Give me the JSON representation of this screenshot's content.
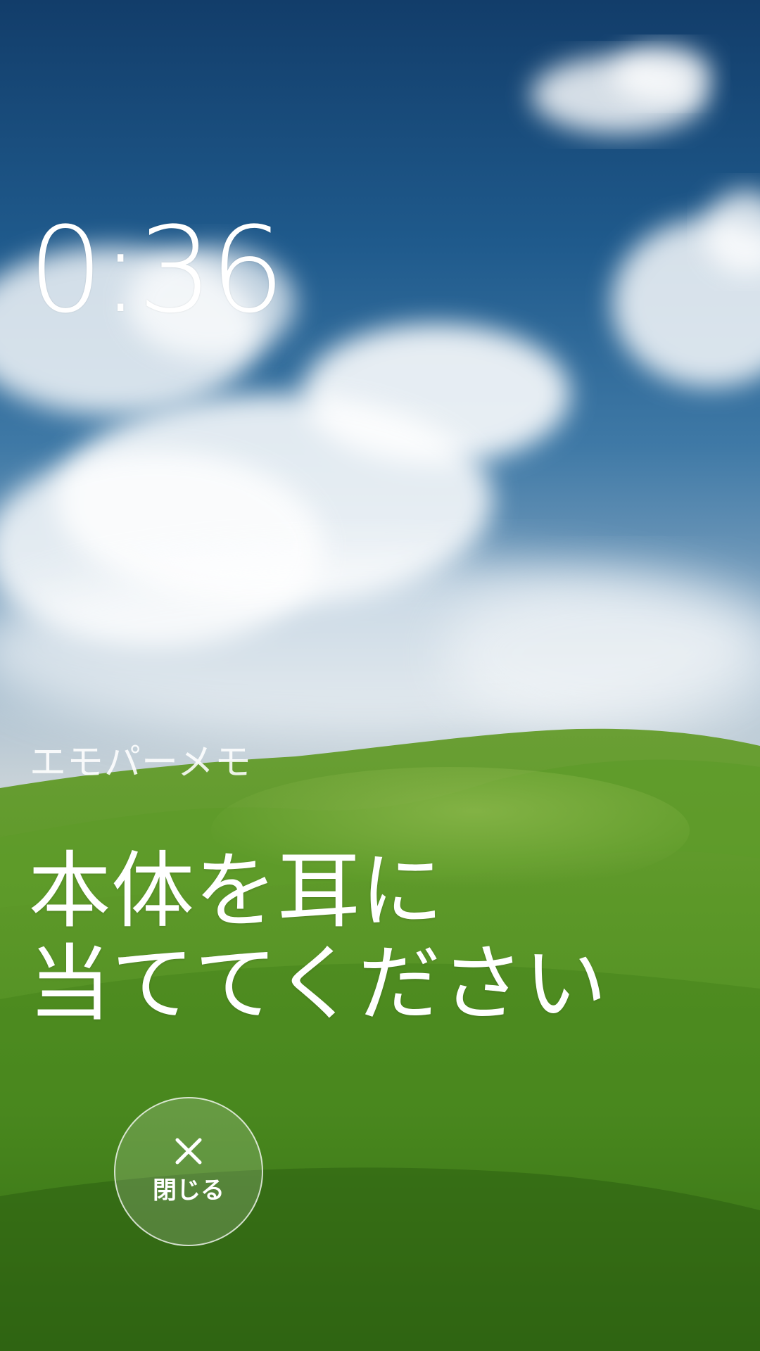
{
  "clock": {
    "time": "0:36"
  },
  "app": {
    "name": "エモパーメモ"
  },
  "instruction": {
    "line1": "本体を耳に",
    "line2": "当ててください"
  },
  "close_button": {
    "label": "閉じる",
    "icon": "close-icon"
  },
  "background": {
    "sky_color": "#1f5a8c",
    "grass_color": "#4f8d26"
  }
}
